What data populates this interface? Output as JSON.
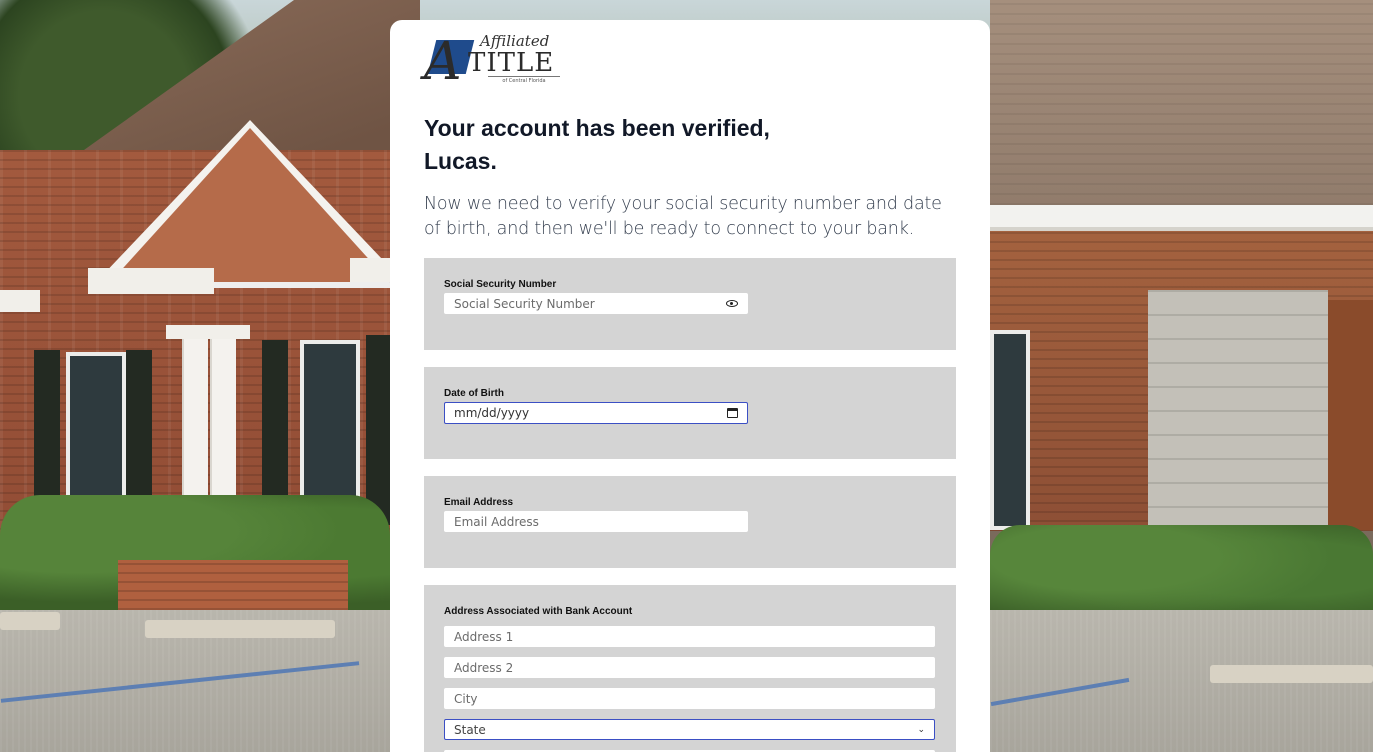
{
  "brand": {
    "logo_script": "Affiliated",
    "logo_title": "TITLE",
    "logo_subtitle": "of Central Florida",
    "accent_color": "#1f4b8c"
  },
  "heading": "Your account has been verified, Lucas.",
  "intro": "Now we need to verify your social security number and date of birth, and then we'll be ready to connect to your bank.",
  "ssn": {
    "label": "Social Security Number",
    "placeholder": "Social Security Number",
    "toggle_icon": "eye-icon"
  },
  "dob": {
    "label": "Date of Birth",
    "placeholder": "mm/dd/yyyy",
    "icon": "calendar-icon"
  },
  "email": {
    "label": "Email Address",
    "placeholder": "Email Address"
  },
  "address": {
    "label": "Address Associated with Bank Account",
    "address1_placeholder": "Address 1",
    "address2_placeholder": "Address 2",
    "city_placeholder": "City",
    "state_selected": "State",
    "state_icon": "chevron-down-icon"
  },
  "colors": {
    "panel_bg": "#d4d4d4",
    "focus_border": "#3b4fc4",
    "heading": "#111827"
  }
}
